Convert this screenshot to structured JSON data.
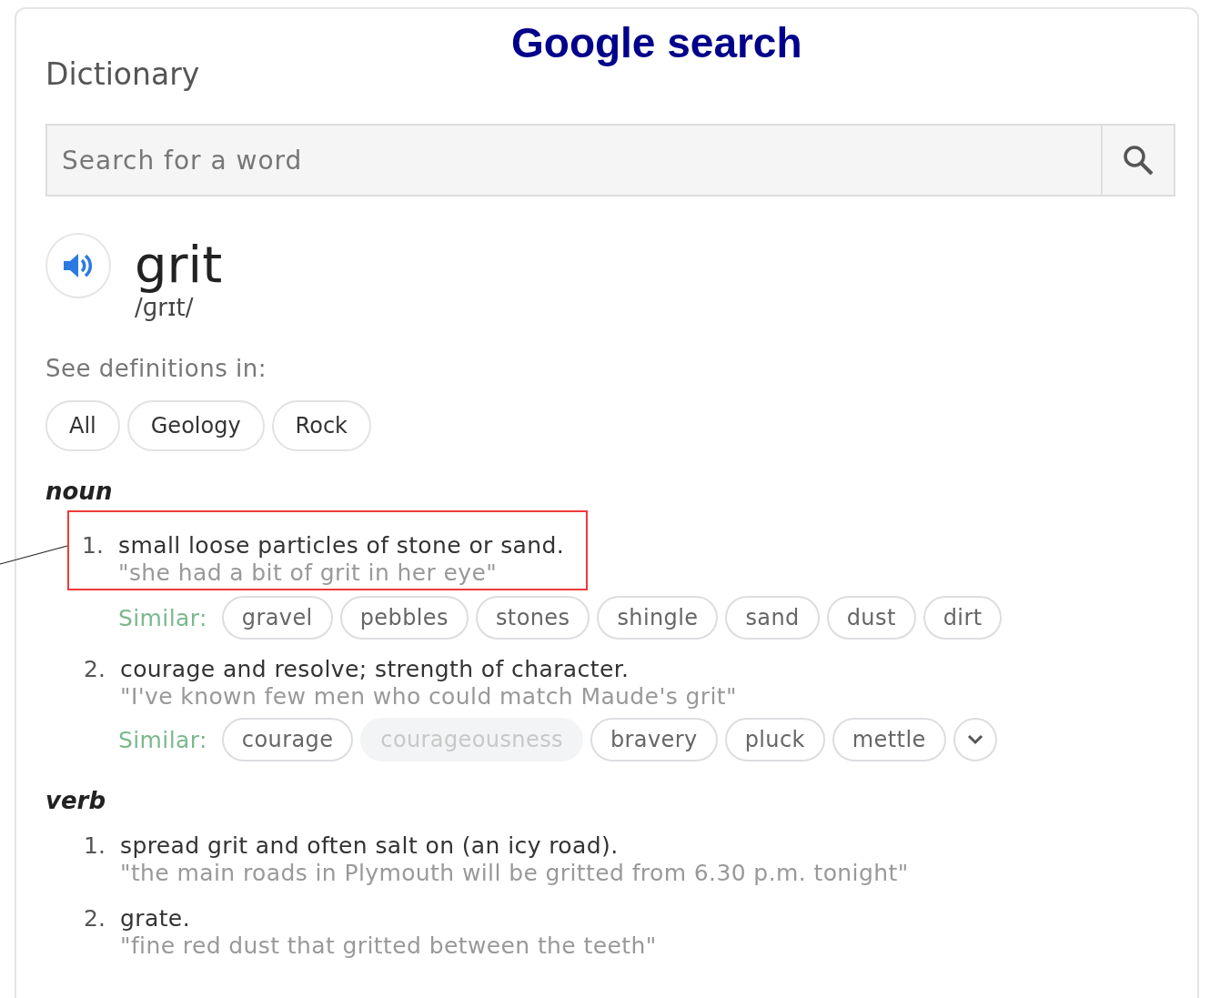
{
  "annotation": {
    "title": "Google search",
    "leader_line": true
  },
  "panel": {
    "title": "Dictionary"
  },
  "search": {
    "placeholder": "Search for a word"
  },
  "entry": {
    "word": "grit",
    "phonetic": "/ɡrɪt/"
  },
  "sources": {
    "label": "See definitions in:",
    "chips": [
      {
        "label": "All"
      },
      {
        "label": "Geology"
      },
      {
        "label": "Rock"
      }
    ]
  },
  "senses": [
    {
      "part_of_speech": "noun",
      "definitions": [
        {
          "number": "1.",
          "text": "small loose particles of stone or sand.",
          "example": "\"she had a bit of grit in her eye\"",
          "highlighted": true,
          "similar": {
            "label": "Similar:",
            "more_button": false,
            "words": [
              {
                "text": "gravel",
                "disabled": false
              },
              {
                "text": "pebbles",
                "disabled": false
              },
              {
                "text": "stones",
                "disabled": false
              },
              {
                "text": "shingle",
                "disabled": false
              },
              {
                "text": "sand",
                "disabled": false
              },
              {
                "text": "dust",
                "disabled": false
              },
              {
                "text": "dirt",
                "disabled": false
              }
            ]
          }
        },
        {
          "number": "2.",
          "text": "courage and resolve; strength of character.",
          "example": "\"I've known few men who could match Maude's grit\"",
          "highlighted": false,
          "similar": {
            "label": "Similar:",
            "more_button": true,
            "words": [
              {
                "text": "courage",
                "disabled": false
              },
              {
                "text": "courageousness",
                "disabled": true
              },
              {
                "text": "bravery",
                "disabled": false
              },
              {
                "text": "pluck",
                "disabled": false
              },
              {
                "text": "mettle",
                "disabled": false
              }
            ]
          }
        }
      ]
    },
    {
      "part_of_speech": "verb",
      "definitions": [
        {
          "number": "1.",
          "text": "spread grit and often salt on (an icy road).",
          "example": "\"the main roads in Plymouth will be gritted from 6.30 p.m. tonight\"",
          "highlighted": false
        },
        {
          "number": "2.",
          "text": "grate.",
          "example": "\"fine red dust that gritted between the teeth\"",
          "highlighted": false
        }
      ]
    }
  ]
}
